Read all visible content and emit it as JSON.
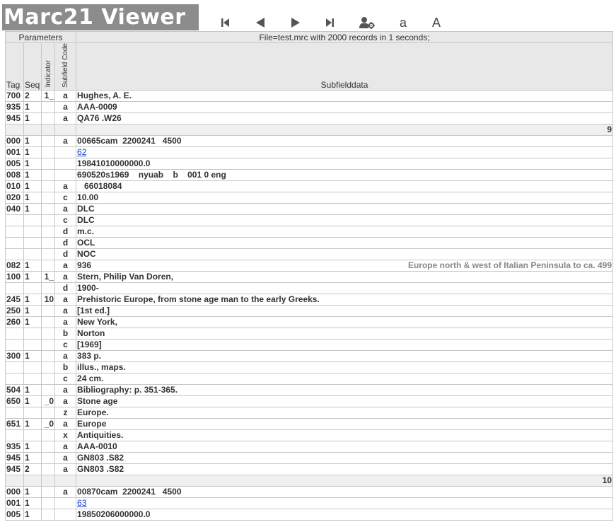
{
  "app": {
    "title": "Marc21 Viewer"
  },
  "toolbar": {
    "first": "first-record-icon",
    "prev": "previous-record-icon",
    "next": "next-record-icon",
    "last": "last-record-icon",
    "settings": "user-settings-icon",
    "font_small": "a",
    "font_large": "A"
  },
  "header": {
    "parameters": "Parameters",
    "file_info": "File=test.mrc with 2000 records in 1 seconds;",
    "col_tag": "Tag",
    "col_seq": "Seq",
    "col_indicator": "Indicator",
    "col_subfield_code": "Subfield Code",
    "col_subfielddata": "Subfielddata"
  },
  "rows": [
    {
      "kind": "field",
      "tag": "700",
      "seq": "2",
      "ind": "1_",
      "code": "a",
      "data": "Hughes, A. E."
    },
    {
      "kind": "field",
      "tag": "935",
      "seq": "1",
      "ind": "",
      "code": "a",
      "data": "AAA-0009"
    },
    {
      "kind": "field",
      "tag": "945",
      "seq": "1",
      "ind": "",
      "code": "a",
      "data": "QA76 .W26"
    },
    {
      "kind": "record",
      "number": "9"
    },
    {
      "kind": "field",
      "tag": "000",
      "seq": "1",
      "ind": "",
      "code": "a",
      "data": "00665cam  2200241   4500"
    },
    {
      "kind": "field",
      "tag": "001",
      "seq": "1",
      "ind": "",
      "code": "",
      "data": "62",
      "link": true
    },
    {
      "kind": "field",
      "tag": "005",
      "seq": "1",
      "ind": "",
      "code": "",
      "data": "19841010000000.0"
    },
    {
      "kind": "field",
      "tag": "008",
      "seq": "1",
      "ind": "",
      "code": "",
      "data": "690520s1969    nyuab    b    001 0 eng"
    },
    {
      "kind": "field",
      "tag": "010",
      "seq": "1",
      "ind": "",
      "code": "a",
      "data": "   66018084"
    },
    {
      "kind": "field",
      "tag": "020",
      "seq": "1",
      "ind": "",
      "code": "c",
      "data": "10.00"
    },
    {
      "kind": "field",
      "tag": "040",
      "seq": "1",
      "ind": "",
      "code": "a",
      "data": "DLC"
    },
    {
      "kind": "field",
      "tag": "",
      "seq": "",
      "ind": "",
      "code": "c",
      "data": "DLC"
    },
    {
      "kind": "field",
      "tag": "",
      "seq": "",
      "ind": "",
      "code": "d",
      "data": "m.c."
    },
    {
      "kind": "field",
      "tag": "",
      "seq": "",
      "ind": "",
      "code": "d",
      "data": "OCL"
    },
    {
      "kind": "field",
      "tag": "",
      "seq": "",
      "ind": "",
      "code": "d",
      "data": "NOC"
    },
    {
      "kind": "field",
      "tag": "082",
      "seq": "1",
      "ind": "",
      "code": "a",
      "data": "936",
      "note": "Europe north & west of Italian Peninsula to ca. 499"
    },
    {
      "kind": "field",
      "tag": "100",
      "seq": "1",
      "ind": "1_",
      "code": "a",
      "data": "Stern, Philip Van Doren,"
    },
    {
      "kind": "field",
      "tag": "",
      "seq": "",
      "ind": "",
      "code": "d",
      "data": "1900-"
    },
    {
      "kind": "field",
      "tag": "245",
      "seq": "1",
      "ind": "10",
      "code": "a",
      "data": "Prehistoric Europe, from stone age man to the early Greeks."
    },
    {
      "kind": "field",
      "tag": "250",
      "seq": "1",
      "ind": "",
      "code": "a",
      "data": "[1st ed.]"
    },
    {
      "kind": "field",
      "tag": "260",
      "seq": "1",
      "ind": "",
      "code": "a",
      "data": "New York,"
    },
    {
      "kind": "field",
      "tag": "",
      "seq": "",
      "ind": "",
      "code": "b",
      "data": "Norton"
    },
    {
      "kind": "field",
      "tag": "",
      "seq": "",
      "ind": "",
      "code": "c",
      "data": "[1969]"
    },
    {
      "kind": "field",
      "tag": "300",
      "seq": "1",
      "ind": "",
      "code": "a",
      "data": "383 p."
    },
    {
      "kind": "field",
      "tag": "",
      "seq": "",
      "ind": "",
      "code": "b",
      "data": "illus., maps."
    },
    {
      "kind": "field",
      "tag": "",
      "seq": "",
      "ind": "",
      "code": "c",
      "data": "24 cm."
    },
    {
      "kind": "field",
      "tag": "504",
      "seq": "1",
      "ind": "",
      "code": "a",
      "data": "Bibliography: p. 351-365."
    },
    {
      "kind": "field",
      "tag": "650",
      "seq": "1",
      "ind": "_0",
      "code": "a",
      "data": "Stone age"
    },
    {
      "kind": "field",
      "tag": "",
      "seq": "",
      "ind": "",
      "code": "z",
      "data": "Europe."
    },
    {
      "kind": "field",
      "tag": "651",
      "seq": "1",
      "ind": "_0",
      "code": "a",
      "data": "Europe"
    },
    {
      "kind": "field",
      "tag": "",
      "seq": "",
      "ind": "",
      "code": "x",
      "data": "Antiquities."
    },
    {
      "kind": "field",
      "tag": "935",
      "seq": "1",
      "ind": "",
      "code": "a",
      "data": "AAA-0010"
    },
    {
      "kind": "field",
      "tag": "945",
      "seq": "1",
      "ind": "",
      "code": "a",
      "data": "GN803 .S82"
    },
    {
      "kind": "field",
      "tag": "945",
      "seq": "2",
      "ind": "",
      "code": "a",
      "data": "GN803 .S82"
    },
    {
      "kind": "record",
      "number": "10"
    },
    {
      "kind": "field",
      "tag": "000",
      "seq": "1",
      "ind": "",
      "code": "a",
      "data": "00870cam  2200241   4500"
    },
    {
      "kind": "field",
      "tag": "001",
      "seq": "1",
      "ind": "",
      "code": "",
      "data": "63",
      "link": true
    },
    {
      "kind": "field",
      "tag": "005",
      "seq": "1",
      "ind": "",
      "code": "",
      "data": "19850206000000.0"
    }
  ]
}
